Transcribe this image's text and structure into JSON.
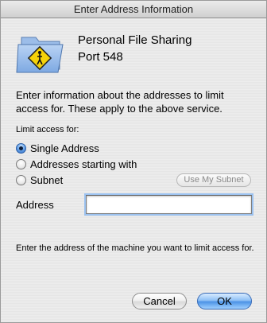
{
  "window": {
    "title": "Enter Address Information"
  },
  "service": {
    "icon": "shared-folder-icon",
    "name": "Personal File Sharing",
    "port": "Port 548"
  },
  "info_text": "Enter information about the addresses to limit access for. These apply to the above service.",
  "limit_access": {
    "label": "Limit access for:",
    "options": [
      {
        "label": "Single Address",
        "selected": true
      },
      {
        "label": "Addresses starting with",
        "selected": false
      },
      {
        "label": "Subnet",
        "selected": false
      }
    ],
    "use_subnet_button": "Use My Subnet"
  },
  "address": {
    "label": "Address",
    "value": ""
  },
  "help_text": "Enter the address of the machine you want to limit access for.",
  "buttons": {
    "cancel": "Cancel",
    "ok": "OK"
  },
  "colors": {
    "accent": "#4c93e6",
    "window_bg": "#ececec"
  }
}
